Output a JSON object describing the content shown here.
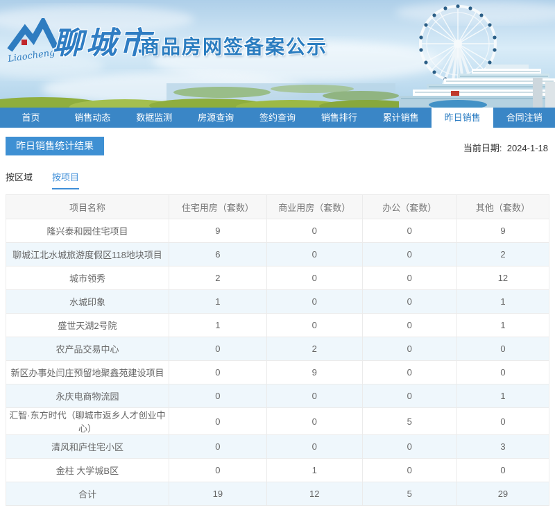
{
  "banner": {
    "logo_text": "Liaocheng",
    "brand": "聊城市",
    "title": "商品房网签备案公示"
  },
  "nav": {
    "items": [
      "首页",
      "销售动态",
      "数据监测",
      "房源查询",
      "签约查询",
      "销售排行",
      "累计销售",
      "昨日销售",
      "合同注销"
    ],
    "active_index": 7
  },
  "page": {
    "section_title": "昨日销售统计结果",
    "date_label": "当前日期:",
    "date_value": "2024-1-18"
  },
  "tabs": {
    "items": [
      "按区域",
      "按项目"
    ],
    "active_index": 1
  },
  "table": {
    "columns": [
      "项目名称",
      "住宅用房（套数）",
      "商业用房（套数）",
      "办公（套数）",
      "其他（套数）"
    ],
    "rows": [
      [
        "隆兴泰和园住宅项目",
        "9",
        "0",
        "0",
        "9"
      ],
      [
        "聊城江北水城旅游度假区118地块项目",
        "6",
        "0",
        "0",
        "2"
      ],
      [
        "城市领秀",
        "2",
        "0",
        "0",
        "12"
      ],
      [
        "水城印象",
        "1",
        "0",
        "0",
        "1"
      ],
      [
        "盛世天湖2号院",
        "1",
        "0",
        "0",
        "1"
      ],
      [
        "农产品交易中心",
        "0",
        "2",
        "0",
        "0"
      ],
      [
        "新区办事处闫庄预留地聚鑫苑建设项目",
        "0",
        "9",
        "0",
        "0"
      ],
      [
        "永庆电商物流园",
        "0",
        "0",
        "0",
        "1"
      ],
      [
        "汇智·东方时代（聊城市返乡人才创业中心）",
        "0",
        "0",
        "5",
        "0"
      ],
      [
        "清风和庐住宅小区",
        "0",
        "0",
        "0",
        "3"
      ],
      [
        "金柱 大学城B区",
        "0",
        "1",
        "0",
        "0"
      ],
      [
        "合计",
        "19",
        "12",
        "5",
        "29"
      ]
    ]
  },
  "colors": {
    "nav_bg": "#3a86c6",
    "accent_blue": "#3e8ed8",
    "section_title_bg": "#3e90d3",
    "brand_blue": "#2b7dc0",
    "table_alt_row": "#eff7fc",
    "table_header_bg": "#f7f7f7",
    "table_border": "#ebebeb"
  }
}
